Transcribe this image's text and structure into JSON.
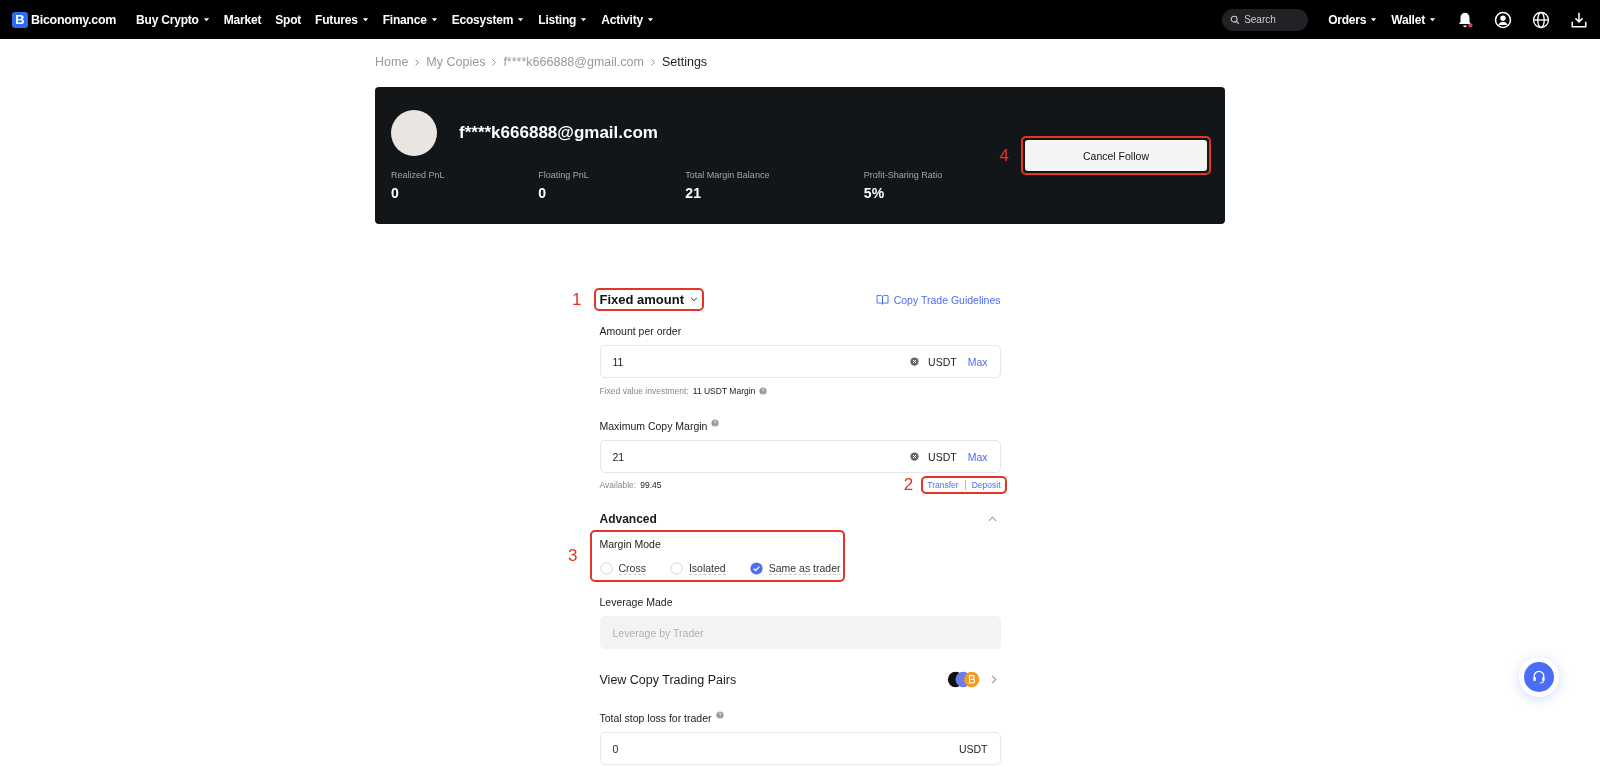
{
  "nav": {
    "logo_letter": "B",
    "logo_text": "Biconomy.com",
    "menu": [
      {
        "label": "Buy Crypto",
        "dropdown": true
      },
      {
        "label": "Market",
        "dropdown": false
      },
      {
        "label": "Spot",
        "dropdown": false
      },
      {
        "label": "Futures",
        "dropdown": true
      },
      {
        "label": "Finance",
        "dropdown": true
      },
      {
        "label": "Ecosystem",
        "dropdown": true
      },
      {
        "label": "Listing",
        "dropdown": true
      },
      {
        "label": "Activity",
        "dropdown": true
      }
    ],
    "search": {
      "placeholder": "Search"
    },
    "right_menu": [
      {
        "label": "Orders",
        "dropdown": true
      },
      {
        "label": "Wallet",
        "dropdown": true
      }
    ],
    "notification_dot": true
  },
  "breadcrumb": [
    {
      "label": "Home",
      "current": false
    },
    {
      "label": "My Copies",
      "current": false
    },
    {
      "label": "f****k666888@gmail.com",
      "current": false
    },
    {
      "label": "Settings",
      "current": true
    }
  ],
  "profile": {
    "name": "f****k666888@gmail.com",
    "stats": [
      {
        "label": "Realized PnL",
        "value": "0"
      },
      {
        "label": "Floating PnL",
        "value": "0"
      },
      {
        "label": "Total Margin Balance",
        "value": "21"
      },
      {
        "label": "Profit-Sharing Ratio",
        "value": "5%"
      }
    ],
    "button": {
      "label": "Cancel Follow",
      "annotation": "4"
    }
  },
  "form": {
    "mode": {
      "label": "Fixed amount",
      "annotation": "1"
    },
    "guidelines_link": "Copy Trade Guidelines",
    "amount": {
      "label": "Amount per order",
      "value": "11",
      "unit": "USDT",
      "max": "Max",
      "hint_label": "Fixed value investment:",
      "hint_value": "11 USDT Margin"
    },
    "max_margin": {
      "label": "Maximum Copy Margin",
      "value": "21",
      "unit": "USDT",
      "max": "Max",
      "available_label": "Available:",
      "available_value": "99.45"
    },
    "links": {
      "annotation": "2",
      "items": [
        "Transfer",
        "Deposit"
      ]
    },
    "advanced": {
      "label": "Advanced",
      "expanded": true
    },
    "margin_mode": {
      "label": "Margin Mode",
      "annotation": "3",
      "options": [
        {
          "label": "Cross",
          "selected": false
        },
        {
          "label": "Isolated",
          "selected": false
        },
        {
          "label": "Same as trader",
          "selected": true
        }
      ]
    },
    "leverage": {
      "label": "Leverage Made",
      "placeholder": "Leverage by Trader"
    },
    "pairs": {
      "label": "View Copy Trading Pairs"
    },
    "stop_loss": {
      "label": "Total stop loss for trader",
      "value": "0",
      "unit": "USDT"
    }
  }
}
